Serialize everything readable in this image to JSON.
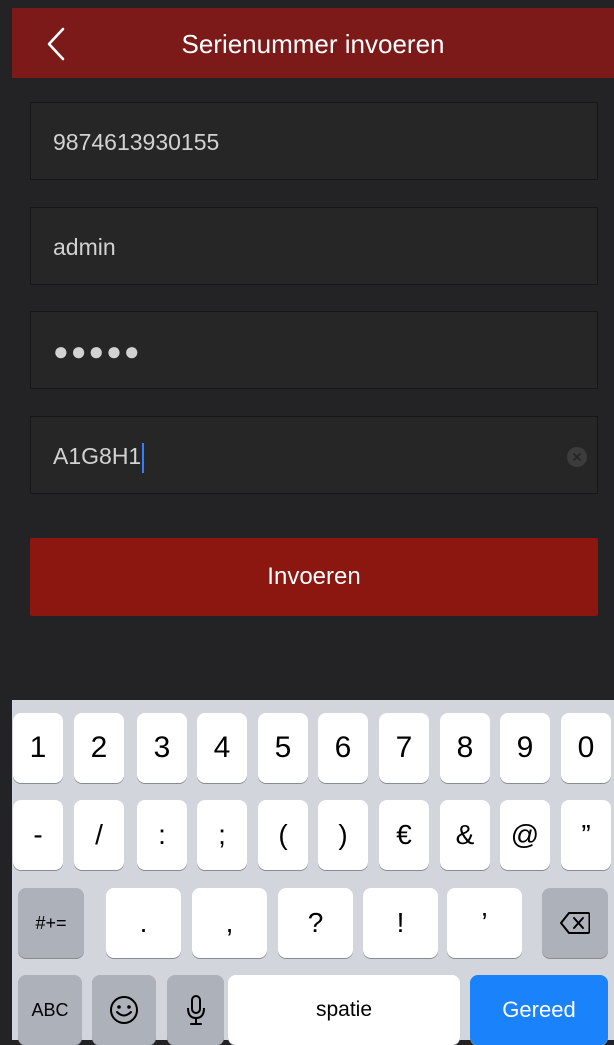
{
  "header": {
    "title": "Serienummer invoeren"
  },
  "fields": {
    "serial": {
      "value": "9874613930155"
    },
    "username": {
      "value": "admin"
    },
    "password": {
      "value": "●●●●●"
    },
    "code": {
      "value": "A1G8H1"
    }
  },
  "submit_label": "Invoeren",
  "keyboard": {
    "row1": [
      "1",
      "2",
      "3",
      "4",
      "5",
      "6",
      "7",
      "8",
      "9",
      "0"
    ],
    "row2": [
      "-",
      "/",
      ":",
      ";",
      "(",
      ")",
      "€",
      "&",
      "@",
      "”"
    ],
    "row3_toggle": "#+=",
    "row3": [
      ".",
      ",",
      "?",
      "!",
      "’"
    ],
    "abc": "ABC",
    "space": "spatie",
    "done": "Gereed"
  },
  "colors": {
    "nav_bar": "#7c1a1a",
    "submit": "#8c1610",
    "background": "#232325",
    "keyboard": "#d2d5db",
    "done_key": "#1a82fb"
  }
}
